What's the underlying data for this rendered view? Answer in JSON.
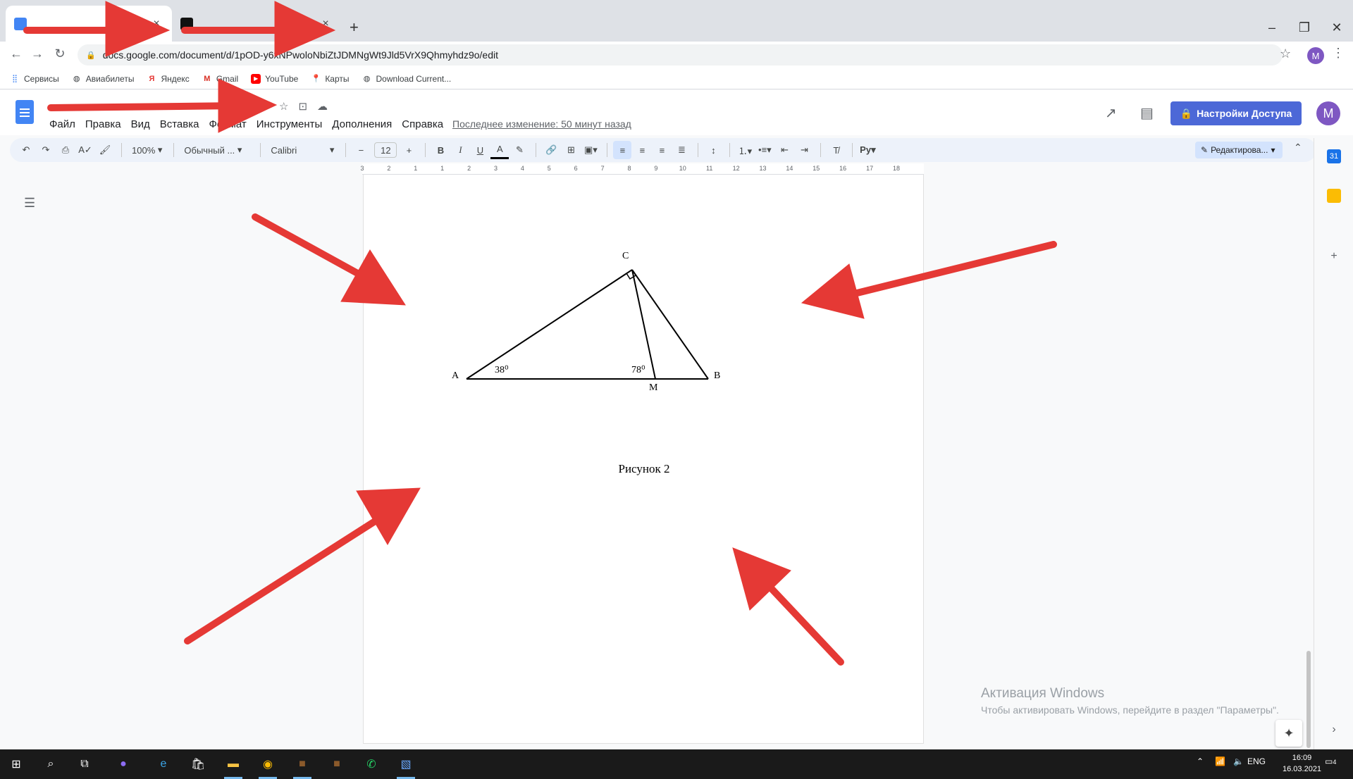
{
  "browser": {
    "tabs": [
      {
        "title": "",
        "active": true
      },
      {
        "title": "",
        "active": false
      }
    ],
    "url": "docs.google.com/document/d/1pOD-y6xNPwoloNbiZtJDMNgWt9Jld5VrX9Qhmyhdz9o/edit",
    "bookmarks": [
      "Сервисы",
      "Авиабилеты",
      "Яндекс",
      "Gmail",
      "YouTube",
      "Карты",
      "Download Current..."
    ],
    "profile_initial": "M"
  },
  "docs": {
    "title": "",
    "menu": [
      "Файл",
      "Правка",
      "Вид",
      "Вставка",
      "Формат",
      "Инструменты",
      "Дополнения",
      "Справка"
    ],
    "last_edit": "Последнее изменение: 50 минут назад",
    "share_label": "Настройки Доступа",
    "avatar_initial": "M"
  },
  "toolbar": {
    "zoom": "100%",
    "style": "Обычный ...",
    "font": "Calibri",
    "font_size": "12",
    "edit_mode": "Редактирова..."
  },
  "ruler": {
    "labels": [
      "3",
      "2",
      "1",
      "1",
      "2",
      "3",
      "4",
      "5",
      "6",
      "7",
      "8",
      "9",
      "10",
      "11",
      "12",
      "13",
      "14",
      "15",
      "16",
      "17",
      "18"
    ]
  },
  "figure": {
    "labels": {
      "A": "A",
      "B": "B",
      "C": "C",
      "M": "M"
    },
    "angle_a": "38⁰",
    "angle_m": "78⁰",
    "caption": "Рисунок 2"
  },
  "watermark": {
    "line1": "Активация Windows",
    "line2": "Чтобы активировать Windows, перейдите в раздел \"Параметры\"."
  },
  "taskbar": {
    "lang": "ENG",
    "time": "16:09",
    "date": "16.03.2021",
    "notifications": "4"
  },
  "colors": {
    "arrow": "#e53935",
    "share_button": "#4c68d7",
    "docs_blue": "#4285f4",
    "avatar": "#7e57c2"
  }
}
